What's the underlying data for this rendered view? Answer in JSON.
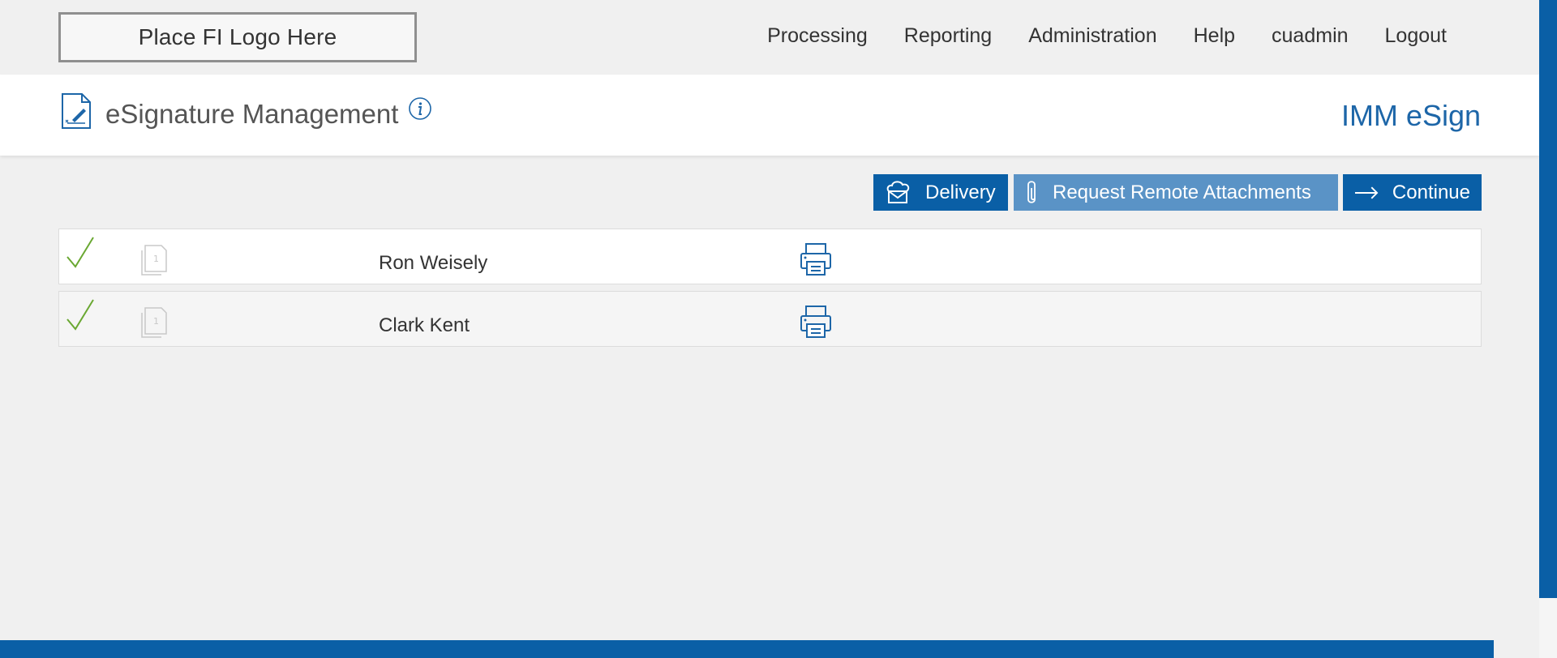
{
  "header": {
    "logo_text": "Place FI Logo Here",
    "nav": [
      "Processing",
      "Reporting",
      "Administration",
      "Help",
      "cuadmin",
      "Logout"
    ]
  },
  "titlebar": {
    "title": "eSignature Management",
    "brand": "IMM eSign"
  },
  "actions": {
    "delivery": "Delivery",
    "attachments": "Request Remote Attachments",
    "continue": "Continue"
  },
  "signers": [
    {
      "name": "Ron Weisely",
      "page_count": "1",
      "status": "complete"
    },
    {
      "name": "Clark Kent",
      "page_count": "1",
      "status": "complete"
    }
  ],
  "colors": {
    "primary": "#0a5fa6",
    "primary_light": "#5a93c6",
    "check": "#6aa832",
    "brand_text": "#1d66a8"
  }
}
